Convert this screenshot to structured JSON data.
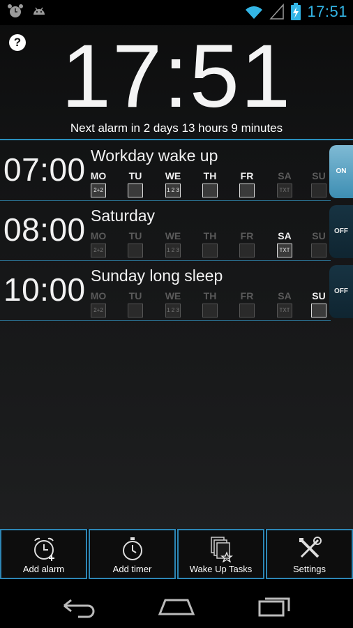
{
  "status_bar": {
    "time": "17:51",
    "left_icons": [
      "alarm-clock-icon",
      "android-icon"
    ],
    "right_icons": [
      "wifi-icon",
      "signal-icon",
      "battery-charging-icon"
    ],
    "accent_color": "#33b5e5"
  },
  "header": {
    "help_label": "?",
    "clock": "17:51",
    "next_alarm": "Next alarm in 2 days 13 hours 9 minutes"
  },
  "alarms": [
    {
      "time": "07:00",
      "name": "Workday wake up",
      "toggle": "ON",
      "days": [
        {
          "label": "MO",
          "active": true,
          "task_label": "2+2"
        },
        {
          "label": "TU",
          "active": true,
          "task_label": ""
        },
        {
          "label": "WE",
          "active": true,
          "task_label": "1 2 3 4"
        },
        {
          "label": "TH",
          "active": true,
          "task_label": ""
        },
        {
          "label": "FR",
          "active": true,
          "task_label": ""
        },
        {
          "label": "SA",
          "active": false,
          "task_label": "TXT"
        },
        {
          "label": "SU",
          "active": false,
          "task_label": ""
        }
      ]
    },
    {
      "time": "08:00",
      "name": "Saturday",
      "toggle": "OFF",
      "days": [
        {
          "label": "MO",
          "active": false,
          "task_label": "2+2"
        },
        {
          "label": "TU",
          "active": false,
          "task_label": ""
        },
        {
          "label": "WE",
          "active": false,
          "task_label": "1 2 3 4"
        },
        {
          "label": "TH",
          "active": false,
          "task_label": ""
        },
        {
          "label": "FR",
          "active": false,
          "task_label": ""
        },
        {
          "label": "SA",
          "active": true,
          "task_label": "TXT"
        },
        {
          "label": "SU",
          "active": false,
          "task_label": ""
        }
      ]
    },
    {
      "time": "10:00",
      "name": "Sunday long sleep",
      "toggle": "OFF",
      "days": [
        {
          "label": "MO",
          "active": false,
          "task_label": "2+2"
        },
        {
          "label": "TU",
          "active": false,
          "task_label": ""
        },
        {
          "label": "WE",
          "active": false,
          "task_label": "1 2 3 4"
        },
        {
          "label": "TH",
          "active": false,
          "task_label": ""
        },
        {
          "label": "FR",
          "active": false,
          "task_label": ""
        },
        {
          "label": "SA",
          "active": false,
          "task_label": "TXT"
        },
        {
          "label": "SU",
          "active": true,
          "task_label": ""
        }
      ]
    }
  ],
  "toolbar": {
    "add_alarm": "Add alarm",
    "add_timer": "Add timer",
    "wake_up_tasks": "Wake Up Tasks",
    "settings": "Settings"
  },
  "nav_icons": [
    "back-icon",
    "home-icon",
    "recent-apps-icon"
  ]
}
